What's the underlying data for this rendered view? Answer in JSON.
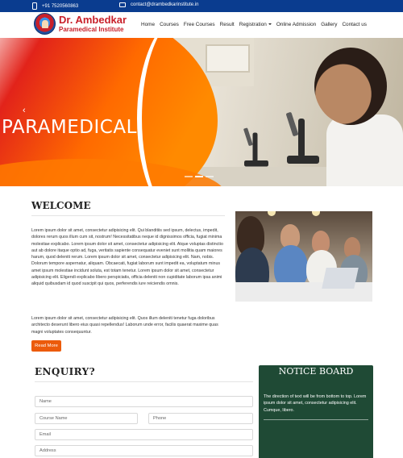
{
  "topbar": {
    "phone": "+91 7520560863",
    "email": "contact@drambedkarinstitute.in",
    "phone_icon": "mobile-phone-icon",
    "email_icon": "envelope-icon"
  },
  "header": {
    "brand_line1": "Dr. Ambedkar",
    "brand_line2": "Paramedical Institute",
    "nav": [
      "Home",
      "Courses",
      "Free Courses",
      "Result",
      "Registration",
      "Online Admission",
      "Gallery",
      "Contact us"
    ]
  },
  "hero": {
    "title": "PARAMEDICAL",
    "prev_icon": "chevron-left-icon",
    "active_slide": 1
  },
  "welcome": {
    "title": "WELCOME",
    "paragraph1": "Lorem ipsum dolor sit amet, consectetur adipisicing elit. Qui blanditiis sed ipsum, delectus, impedit, dolores rerum quos illum cum sit, nostrum! Necessitatibus neque id dignissimos officia, fugiat minima molestiae explicabo. Lorem ipsum dolor sit amet, consectetur adipisicing elit. Atque voluptas distinctio aut ab dolore itaque optio ad, fuga, veritatis sapiente consequatur eveniet sunt mollitia quam maiores harum, quod deleniti rerum. Lorem ipsum dolor sit amet, consectetur adipisicing elit. Nam, nobis. Dolorum tempore aspernatur, aliquam. Obcaecati, fugiat laborum sunt impedit ea, voluptatum minus amet ipsum molestiae incidunt soluta, est totam tenetur. Lorem ipsum dolor sit amet, consectetur adipisicing elit. Eligendi explicabo libero perspiciatis, officia deleniti non cupiditate laborum ipsa animi aliquid quibusdam id quod suscipit qui quos, perferendis iure reiciendis omnis.",
    "paragraph2": "Lorem ipsum dolor sit amet, consectetur adipisicing elit. Quos illum deleniti tenetur fuga doloribus architecto deserunt libero eius quasi repellendus! Laborum unde error, facilis quaerat maxime quas magni voluptates consequuntur.",
    "read_more": "Read More"
  },
  "enquiry": {
    "title": "ENQUIRY?",
    "name_placeholder": "Name",
    "course_placeholder": "Course Name",
    "phone_placeholder": "Phone",
    "email_placeholder": "Email",
    "address_placeholder": "Address"
  },
  "notice": {
    "title": "NOTICE BOARD",
    "text": "The direction of text will be from bottom to top. Lorem ipsum dolor sit amet, consectetur adipisicing elit. Cumque, libero."
  },
  "colors": {
    "topbar": "#0a3c8f",
    "brand": "#c8202a",
    "accent": "#ec5b0b",
    "notice_bg": "#1f4a35"
  }
}
